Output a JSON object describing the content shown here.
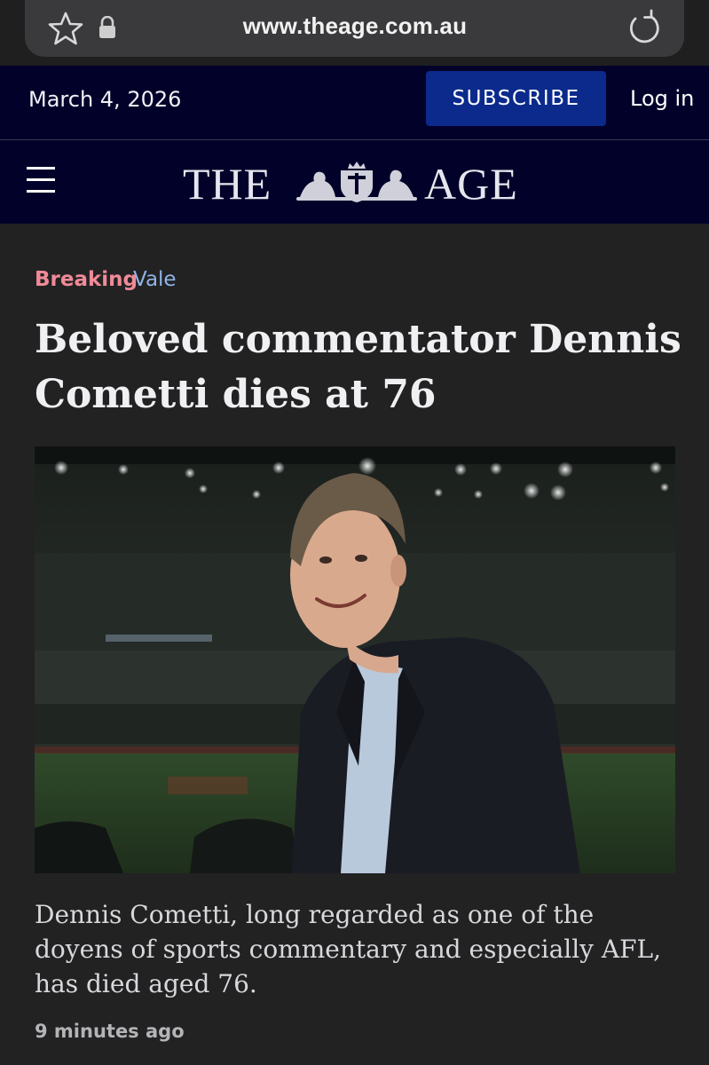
{
  "browser": {
    "url": "www.theage.com.au",
    "icons": [
      "star-icon",
      "lock-icon",
      "reload-icon"
    ]
  },
  "topbar": {
    "date": "March 4, 2026",
    "subscribe_label": "SUBSCRIBE",
    "login_label": "Log in"
  },
  "masthead": {
    "logo_left": "THE",
    "logo_right": "AGE",
    "icons": [
      "menu-icon",
      "crest-icon"
    ]
  },
  "article": {
    "kicker_primary": "Breaking",
    "kicker_secondary": "Vale",
    "headline": "Beloved commentator Dennis Cometti dies at 76",
    "caption": "Dennis Cometti, long regarded as one of the doyens of sports commentary and especially AFL, has died aged 76.",
    "timestamp": "9 minutes ago"
  },
  "colors": {
    "page_bg": "#222223",
    "navy": "#01012a",
    "subscribe_bg": "#0b2a8c",
    "breaking": "#f08a97",
    "vale": "#8fb4e6"
  }
}
